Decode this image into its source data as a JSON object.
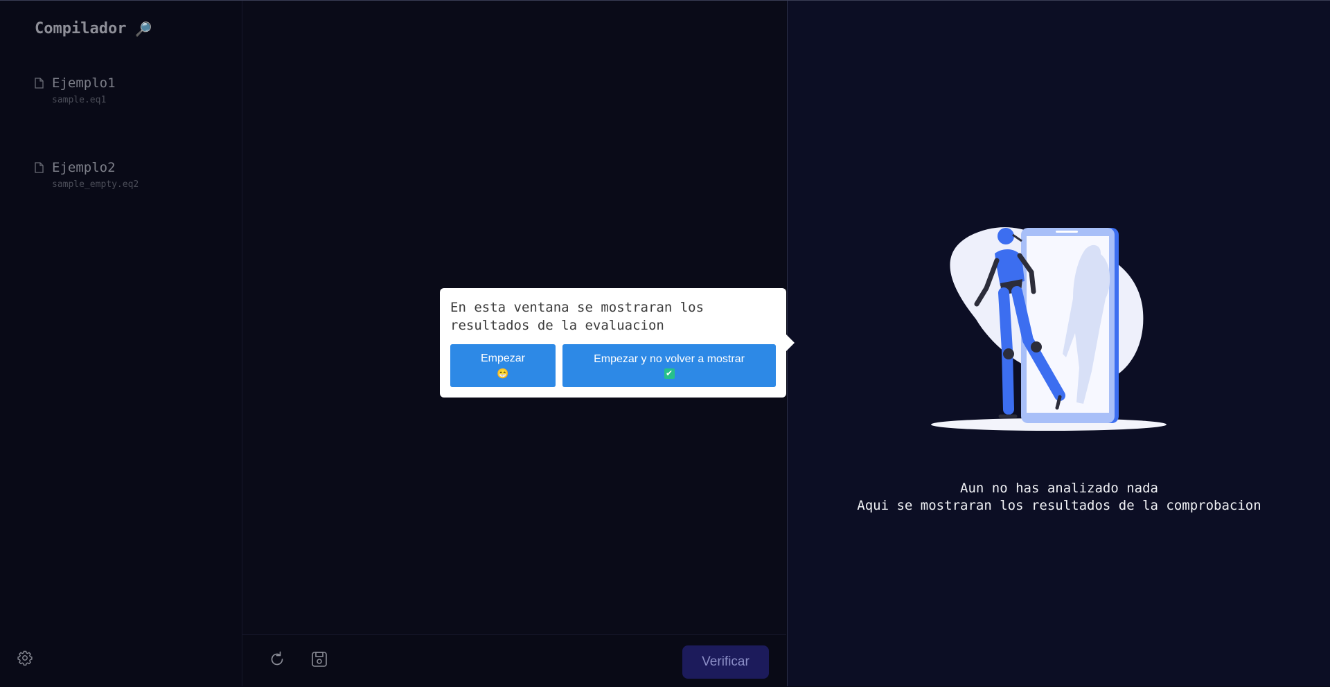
{
  "app": {
    "title": "Compilador",
    "title_icon": "🔎"
  },
  "sidebar": {
    "files": [
      {
        "name": "Ejemplo1",
        "filename": "sample.eq1"
      },
      {
        "name": "Ejemplo2",
        "filename": "sample_empty.eq2"
      }
    ]
  },
  "editor": {
    "verify_label": "Verificar"
  },
  "results": {
    "empty_line1": "Aun no has analizado nada",
    "empty_line2": "Aqui se mostraran los resultados de la comprobacion"
  },
  "popover": {
    "text": "En esta ventana se mostraran los resultados de la evaluacion",
    "start_label": "Empezar",
    "start_emoji": "😁",
    "start_no_show_label": "Empezar y no volver a mostrar",
    "start_no_show_emoji": "✔"
  },
  "colors": {
    "background": "#090a17",
    "results_background": "#0c0e24",
    "accent_blue": "#2d89e6",
    "verify_button": "#1c1b5b",
    "illustration_blue": "#3c6ef0"
  }
}
